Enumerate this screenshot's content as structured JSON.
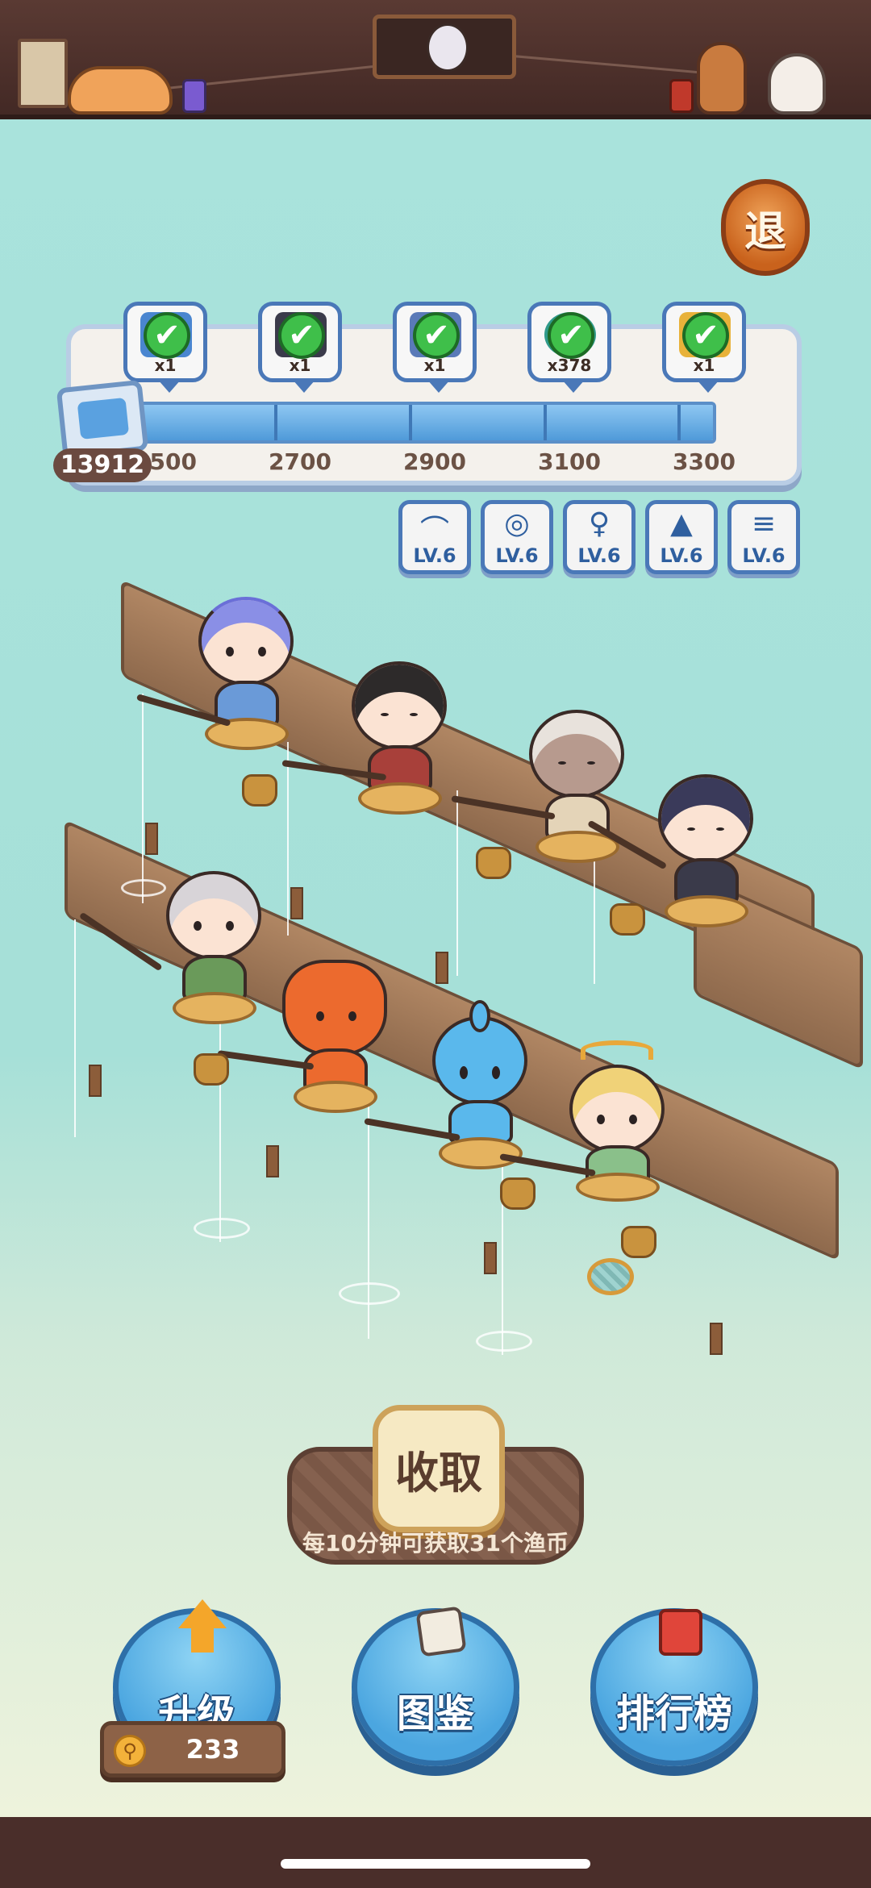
{
  "header": {
    "scroll_icon": "hanging-scroll-icon",
    "avatar_icon": "glasses-cat-portrait-icon"
  },
  "exit": {
    "label": "退"
  },
  "progress": {
    "score": "13912",
    "fill_fraction": 1.0,
    "milestones": [
      {
        "label": "2500",
        "reward_count": "x1",
        "claimed": true
      },
      {
        "label": "2700",
        "reward_count": "x1",
        "claimed": true
      },
      {
        "label": "2900",
        "reward_count": "x1",
        "claimed": true
      },
      {
        "label": "3100",
        "reward_count": "x378",
        "claimed": true
      },
      {
        "label": "3300",
        "reward_count": "x1",
        "claimed": true
      }
    ],
    "check_glyph": "✔"
  },
  "equipment": [
    {
      "icon": "fishing-rod-icon",
      "glyph": "⌒",
      "level": "LV.6"
    },
    {
      "icon": "reel-icon",
      "glyph": "◎",
      "level": "LV.6"
    },
    {
      "icon": "hook-icon",
      "glyph": "♀",
      "level": "LV.6"
    },
    {
      "icon": "hat-icon",
      "glyph": "▲",
      "level": "LV.6"
    },
    {
      "icon": "stool-icon",
      "glyph": "≡",
      "level": "LV.6"
    }
  ],
  "collect": {
    "button_label": "收取",
    "note": "每10分钟可获取31个渔币"
  },
  "nav": {
    "upgrade_label": "升级",
    "upgrade_cost": "233",
    "catalog_label": "图鉴",
    "ranking_label": "排行榜"
  },
  "colors": {
    "sea": "#a8e2dc",
    "panel_border": "#4a78b8",
    "button_blue": "#4ba6e0",
    "wood": "#8f6a4d"
  }
}
